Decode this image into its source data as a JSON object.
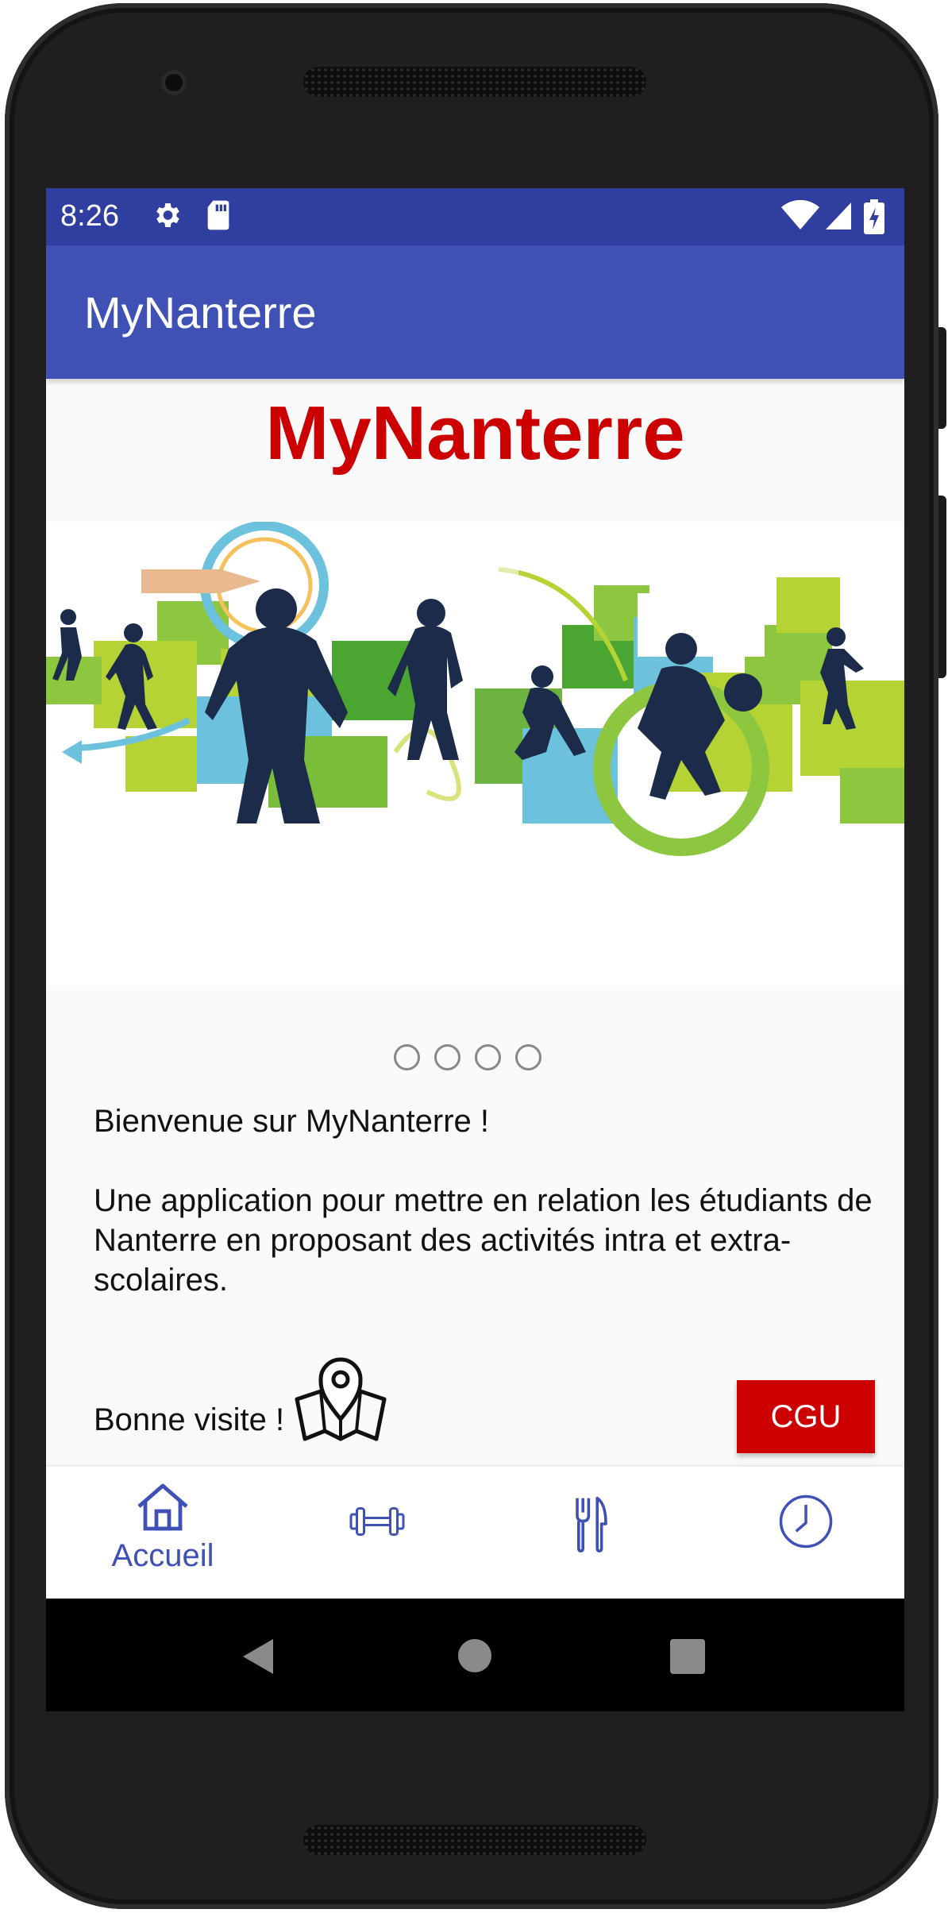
{
  "status_bar": {
    "time": "8:26",
    "icons": [
      "gear-icon",
      "sd-card-icon",
      "wifi-icon",
      "cell-signal-icon",
      "battery-charging-icon"
    ]
  },
  "app_bar": {
    "title": "MyNanterre"
  },
  "hero": {
    "title": "MyNanterre"
  },
  "carousel": {
    "slide_count": 4,
    "active_index": 0,
    "image": "sports-silhouettes-banner"
  },
  "content": {
    "welcome": "Bienvenue sur MyNanterre !",
    "description": "Une application pour mettre en relation les étudiants de Nanterre en proposant des activités intra et extra-scolaires.",
    "farewell": "Bonne visite !",
    "cgu_label": "CGU"
  },
  "bottom_nav": {
    "items": [
      {
        "label": "Accueil",
        "icon": "home-icon",
        "active": true
      },
      {
        "label": "",
        "icon": "dumbbell-icon",
        "active": false
      },
      {
        "label": "",
        "icon": "fork-knife-icon",
        "active": false
      },
      {
        "label": "",
        "icon": "clock-icon",
        "active": false
      }
    ]
  },
  "system_nav": {
    "buttons": [
      "back-button",
      "home-button",
      "recents-button"
    ]
  },
  "colors": {
    "status_bar": "#303f9f",
    "app_bar": "#3f51b5",
    "accent_red": "#cc0000",
    "nav_icon": "#3f51b5"
  }
}
